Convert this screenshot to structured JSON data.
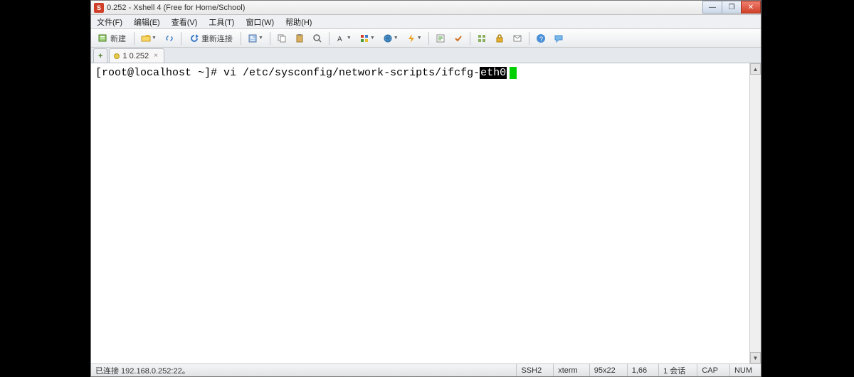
{
  "titlebar": {
    "title": "0.252 - Xshell 4 (Free for Home/School)",
    "icon_glyph": "S"
  },
  "window_controls": {
    "minimize": "—",
    "maximize": "❐",
    "close": "✕"
  },
  "menu": {
    "file": "文件(F)",
    "edit": "编辑(E)",
    "view": "查看(V)",
    "tools": "工具(T)",
    "window": "窗口(W)",
    "help": "帮助(H)"
  },
  "toolbar": {
    "new_label": "新建",
    "reconnect_label": "重新连接"
  },
  "tabs": {
    "plus": "+",
    "main": {
      "label": "1 0.252",
      "close": "×"
    }
  },
  "terminal": {
    "prompt_prefix": "[root@localhost ~]# vi /etc/sysconfig/network-scripts/ifcfg-",
    "highlighted": "eth0"
  },
  "statusbar": {
    "connected": "已连接 192.168.0.252:22。",
    "protocol": "SSH2",
    "term": "xterm",
    "size": "95x22",
    "pos": "1,66",
    "sessions": "1 会话",
    "caps": "CAP",
    "num": "NUM"
  }
}
